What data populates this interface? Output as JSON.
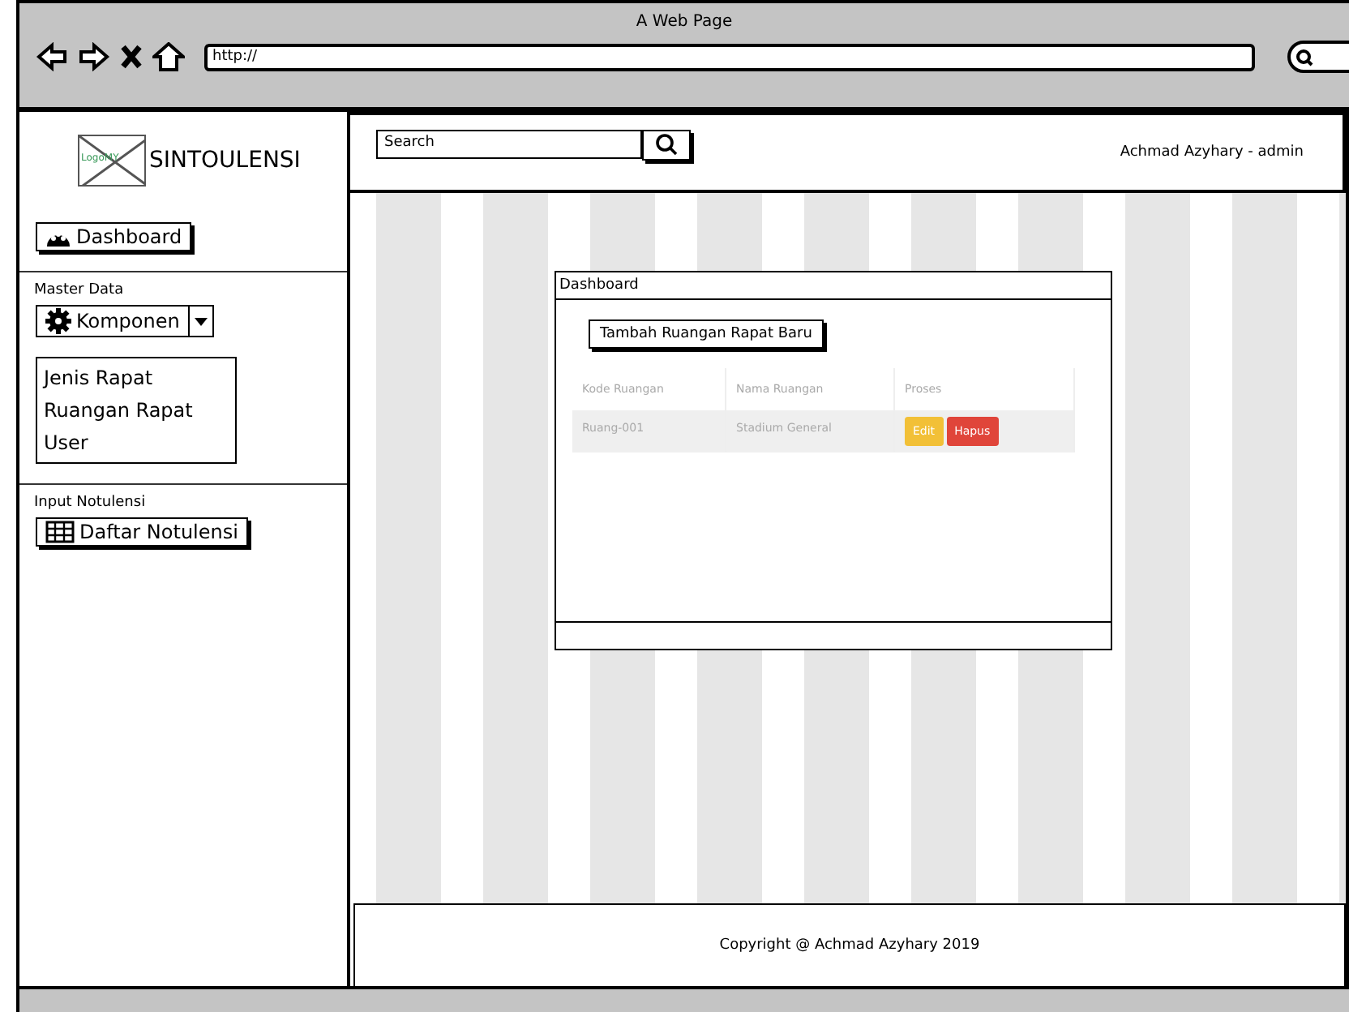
{
  "browser": {
    "title": "A Web Page",
    "address": "http://"
  },
  "sidebar": {
    "logo_text": "LogoMY",
    "brand": "SINTOULENSI",
    "dashboard": "Dashboard",
    "sections": [
      {
        "heading": "Master Data",
        "kind": "dropdown",
        "button": "Komponen",
        "items": [
          "Jenis Rapat",
          "Ruangan Rapat",
          "User"
        ]
      },
      {
        "heading": "Input Notulensi",
        "kind": "button",
        "button": "Daftar Notulensi"
      }
    ]
  },
  "header": {
    "search": {
      "placeholder": "Search"
    },
    "user": "Achmad Azyhary - admin"
  },
  "panel": {
    "title": "Dashboard",
    "add_button": "Tambah Ruangan Rapat Baru",
    "table": {
      "columns": [
        "Kode Ruangan",
        "Nama Ruangan",
        "Proses"
      ],
      "rows": [
        {
          "cells": [
            "Ruang-001",
            "Stadium General"
          ],
          "actions": [
            {
              "label": "Edit",
              "kind": "edit"
            },
            {
              "label": "Hapus",
              "kind": "delete"
            }
          ]
        }
      ]
    }
  },
  "footer": "Copyright @ Achmad Azyhary 2019"
}
